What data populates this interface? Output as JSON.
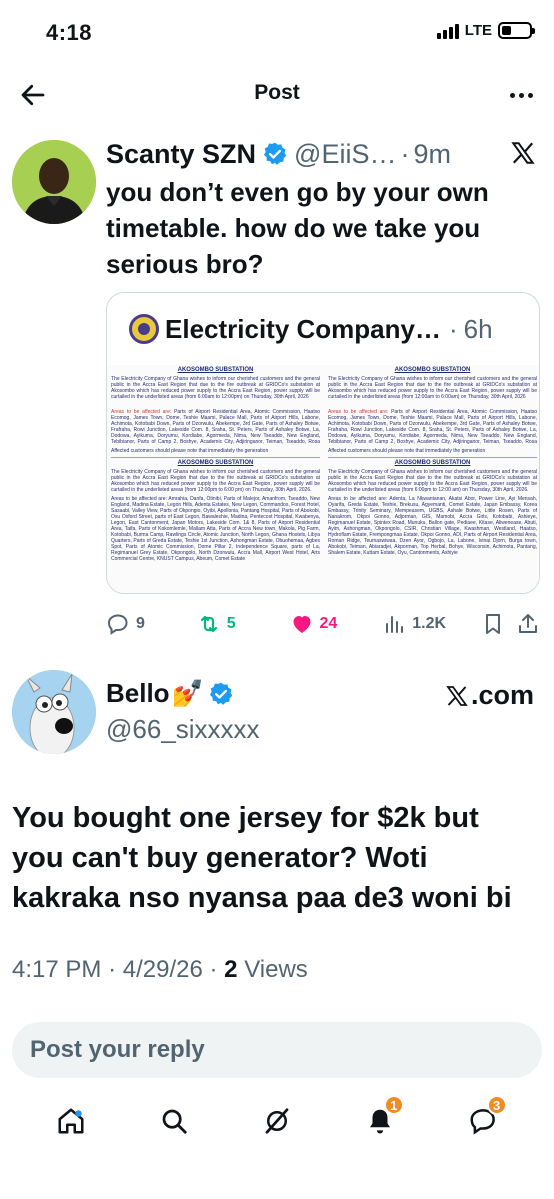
{
  "status_bar": {
    "time": "4:18",
    "network": "LTE",
    "battery_level": 0.35
  },
  "header": {
    "title": "Post",
    "back_icon": "arrow-left-icon",
    "more_icon": "more-horizontal-icon"
  },
  "quoted_tweet": {
    "name": "Scanty SZN",
    "handle": "@EiiS…",
    "separator": "·",
    "time": "9m",
    "text": "you don’t even go by your own timetable. how do we take you serious bro?",
    "card": {
      "account_name": "Electricity Company…",
      "separator": "·",
      "time": "6h",
      "doc_heading": "AKOSOMBO SUBSTATION",
      "doc_intro_a": "The Electricity Company of Ghana wishes to inform our cherished customers and the general public in the Accra East Region that due to the fire outbreak at GRIDCo's substation at Akosombo which has reduced power supply to the Accra East Region, power supply will be curtailed in the underlisted areas (from 6:00am to 12:00pm) on Thursday, 30th April, 2026",
      "doc_intro_b": "The Electricity Company of Ghana wishes to inform our cherished customers and the general public in the Accra East Region that due to the fire outbreak at GRIDCo's substation at Akosombo which has reduced power supply to the Accra East Region, power supply will be curtailed in the underlisted areas (from 12:00am to 6:00am) on Thursday, 30th April, 2026",
      "doc_areas_label": "Areas to be affected are:",
      "doc_areas_a": "Parts of Airport Residential Area, Atomic Commission, Haatso Ecomog, James Town, Dome, Teshie Maami, Palace Mall, Parts of Airport Hills, Labone, Achimota, Kotobabi Down, Parts of Dzorwulu, Abekempe, 3rd Gate, Parts of Ashaley Botwe, Frafraha, Rowi Junction, Lakeside Com. 8, Sraha, St. Peters, Parts of Ashaley Botwe, La, Dodowa, Ayikuma, Doryumu, Kordiabe, Agormeda, Nima, New Tseaddo, New England, Tebibianor, Parts of Camp 2, Boshye, Academic City, Adjiringanor, Teiman, Tseaddo, Rosa Rosa, Ayi Mensah, Danfa, Parts of Oyarifa, Comet Estate, and parts of Madina.",
      "doc_note": "Affected customers should please note that immediately the generation",
      "doc_intro_c": "The Electricity Company of Ghana wishes to inform our cherished customers and the general public in the Accra East Region that due to the fire outbreak at GRIDCo's substation at Akosombo which has reduced power supply to the Accra East Region, power supply will be curtailed in the underlisted areas (from 12:00pm to 6:00 pm) on Thursday, 30th April, 2026.",
      "doc_intro_d": "The Electricity Company of Ghana wishes to inform our cherished customers and the general public in the Accra East Region that due to the fire outbreak at GRIDCo's substation at Akosombo which has reduced power supply to the Accra East Region, power supply will be curtailed in the underlisted areas (from 6:00pm to 12:00 am) on Thursday, 30th April, 2026.",
      "doc_areas_c": "Amrahia, Danfa, Otinibi, Parts of Malejor, Amanfrom, Tseaddo, New England, Madina Estate, Legon Hills, Adenta Estates, New Legon, Commandos, Forest Hotel, Sasaabi, Valley View, Parts of Okpongio, Oyibi, Apollonia, Pantang Hospital, Parts of Abokobi, Oxu Oxford Street, parts of East Legon, Bawaleshie, Madina, Pentecost Hospital, Kwabenya, Legon, East Cantonment, Japan Motors, Lakeside Com. 1& 8, Parts of Airport Residential Area, Taifa, Parts of Kokomlemle, Mallam Atta, Parts of Accra New town, Makola, Pig Farm, Kotobabi, Burma Camp, Rawlings Circle, Atomic Junction, North Legon, Ghana Hostels, Libya Quarters, Parts of Greda Estate, Teshie 1st Junction, Ashongman Estate, Obuohemaa, Agbes Spot, Parts of Atomic Commission, Dome Pillar 2, Independence Square, parts of La, Regimanuel Grey Estate, Okpongolo, North Dzorwulu, Accra Mall, Airport West Hotel, Arts Commercial Centre, KNUST Campus, Abeum, Comet Estate",
      "doc_areas_d": "Adenta, La Nkwantanan, Akatsi Abor, Power Line, Ayi Mensah, Oyarifa, Greda Estate, Teshie, Brekusu, Agyemanti, Comet Estate, Japan Embassy, Korea Embassy, Trinity Seminary, Mempeasem, UGBS, Ashale Botwe, Little Rosen, Parts of Nanakrom, Okpoi Gonno, Adjorman, GIS, Mamobi, Accra Girls, Kotobabi, Ashieye, Regimanuel Estate, Spintex Road, Munuku, Ballon gate, Pediaee, Kitase, Aliwenease, Abuti, Ayim, Ashongman, Okpongolo, CSIR, Christian Village, Kwashman, Westland, Haatso, Hydroflam Estate, Frempongmaa Estate, Okpoi Gonno, ADI, Parts of Airport Residential Area, Roman Ridge, Teumaswiwaa, Dzen Ayor, Ogbojo, La, Labone, Ivinai Djorn, Burga town, Abokobi, Teiman, Abiaradjei, Akporman, Top Herbal, Bohye, Wisconsin, Achimota, Pantang, Shalem Estate, Kuttam Estate, Oyu, Cantonments, Ashiyie"
    },
    "actions": {
      "replies": "9",
      "reposts": "5",
      "likes": "24",
      "views": "1.2K"
    }
  },
  "post": {
    "name": "Bello",
    "name_emoji": "💅",
    "handle": "@66_sixxxxx",
    "watermark": ".com",
    "text": "You bought one jersey for $2k but you can't buy generator? Woti kakraka nso nyansa paa de3 woni bi",
    "time": "4:17 PM",
    "separator": "·",
    "date": "4/29/26",
    "separator2": "·",
    "views_count": "2",
    "views_label": "Views"
  },
  "reply": {
    "placeholder": "Post your reply"
  },
  "nav": {
    "notifications_badge": "1",
    "messages_badge": "3"
  },
  "colors": {
    "accent": "#1d9bf0",
    "like": "#f91880",
    "repost": "#00ba7c",
    "badge": "#f28b24"
  }
}
